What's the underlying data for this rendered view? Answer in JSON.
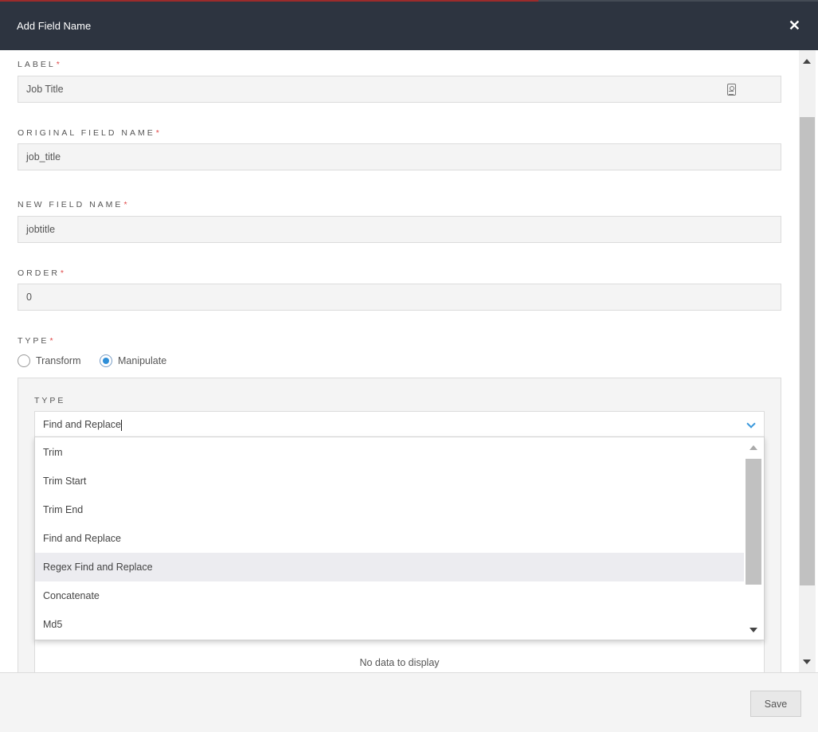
{
  "modal": {
    "title": "Add Field Name",
    "close_glyph": "✕"
  },
  "fields": {
    "label": {
      "label": "LABEL",
      "required_mark": "*",
      "value": "Job Title",
      "icon": "contact-card-icon"
    },
    "original_field_name": {
      "label": "ORIGINAL FIELD NAME",
      "required_mark": "*",
      "value": "job_title"
    },
    "new_field_name": {
      "label": "NEW FIELD NAME",
      "required_mark": "*",
      "value": "jobtitle"
    },
    "order": {
      "label": "ORDER",
      "required_mark": "*",
      "value": "0"
    }
  },
  "type": {
    "label": "TYPE",
    "required_mark": "*",
    "options": [
      {
        "label": "Transform",
        "checked": false
      },
      {
        "label": "Manipulate",
        "checked": true
      }
    ]
  },
  "manipulate": {
    "type_label": "TYPE",
    "selected_value": "Find and Replace",
    "dropdown_options": [
      "Trim",
      "Trim Start",
      "Trim End",
      "Find and Replace",
      "Regex Find and Replace",
      "Concatenate",
      "Md5"
    ],
    "hovered_option": "Regex Find and Replace",
    "grid_empty_text": "No data to display"
  },
  "footer": {
    "save_label": "Save"
  },
  "colors": {
    "header_bg": "#2d3440",
    "required": "#e04848",
    "accent": "#2f8fd8"
  }
}
